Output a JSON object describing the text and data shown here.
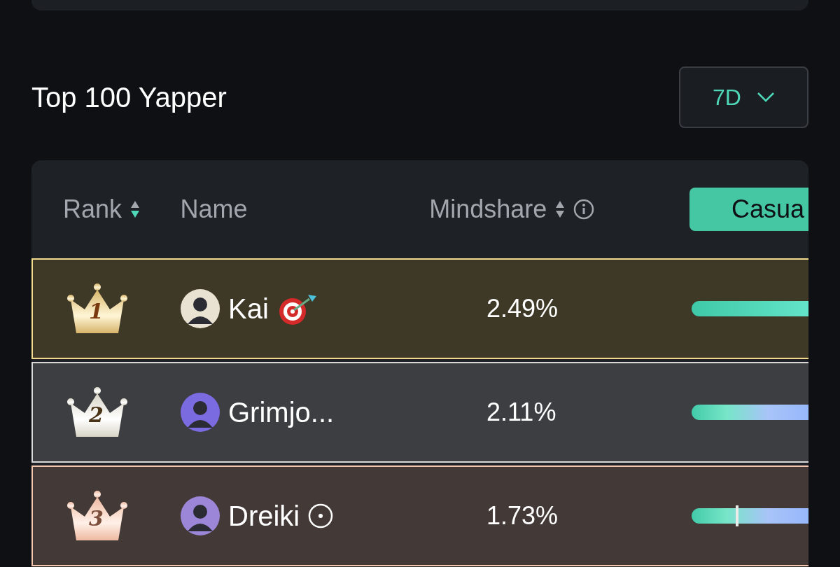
{
  "title": "Top 100 Yapper",
  "period": {
    "value": "7D"
  },
  "columns": [
    {
      "label": "Rank",
      "sortable": true,
      "sorted": true,
      "info": false
    },
    {
      "label": "Name",
      "sortable": false,
      "info": false
    },
    {
      "label": "Mindshare",
      "sortable": true,
      "sorted": false,
      "info": true
    }
  ],
  "mode_button": {
    "label": "Casua",
    "selected": true
  },
  "rows": [
    {
      "kind": "gold",
      "rank": "1",
      "name": "Kai",
      "badge": {
        "kind": "target"
      },
      "mindshare": "2.49%",
      "color": "#e9e1d2",
      "bar": {
        "kind": "teal",
        "marker": false
      }
    },
    {
      "kind": "silver",
      "rank": "2",
      "name": "Grimjo...",
      "mindshare": "2.11%",
      "color": "#7a6be0",
      "bar": {
        "kind": "blend",
        "marker": false
      }
    },
    {
      "kind": "bronze",
      "rank": "3",
      "name": "Dreiki",
      "badge": {
        "kind": "dot"
      },
      "mindshare": "1.73%",
      "color": "#9c86d8",
      "bar": {
        "kind": "blend",
        "marker": true
      }
    }
  ]
}
